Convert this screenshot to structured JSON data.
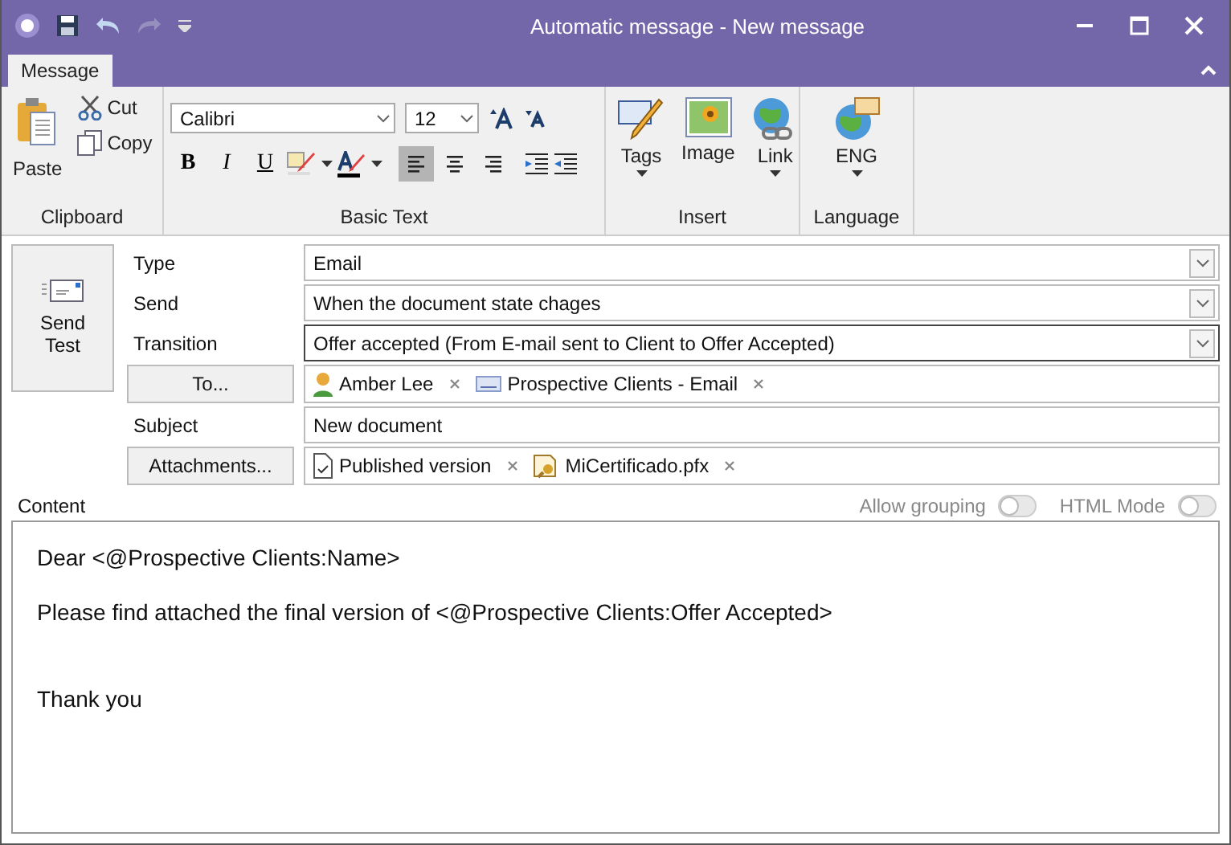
{
  "window": {
    "title": "Automatic message - New message"
  },
  "tabs": [
    {
      "label": "Message",
      "selected": true
    }
  ],
  "ribbon": {
    "clipboard": {
      "label": "Clipboard",
      "paste": "Paste",
      "cut": "Cut",
      "copy": "Copy"
    },
    "basic_text": {
      "label": "Basic Text",
      "font": "Calibri",
      "size": "12",
      "format": [
        {
          "kind": "bold",
          "label": "B"
        },
        {
          "kind": "italic",
          "label": "I"
        },
        {
          "kind": "underline",
          "label": "U"
        }
      ],
      "alignment": [
        {
          "kind": "left",
          "selected": true
        },
        {
          "kind": "center",
          "selected": false
        },
        {
          "kind": "right",
          "selected": false
        }
      ]
    },
    "insert": {
      "label": "Insert",
      "buttons": [
        {
          "kind": "tags",
          "label": "Tags",
          "dropdown": true
        },
        {
          "kind": "image",
          "label": "Image",
          "dropdown": false
        },
        {
          "kind": "link",
          "label": "Link",
          "dropdown": true
        }
      ]
    },
    "language": {
      "label": "Language",
      "value": "ENG"
    }
  },
  "send_test": "Send Test",
  "fields": [
    {
      "kind": "select",
      "label": "Type",
      "value": "Email",
      "focused": false
    },
    {
      "kind": "select",
      "label": "Send",
      "value": "When the document state chages",
      "focused": false
    },
    {
      "kind": "select",
      "label": "Transition",
      "value": "Offer accepted (From E-mail sent to Client to Offer Accepted)",
      "focused": true
    },
    {
      "kind": "chips",
      "button": "To...",
      "chips": [
        {
          "kind": "contact",
          "text": "Amber Lee"
        },
        {
          "kind": "group",
          "text": "Prospective Clients - Email"
        }
      ]
    },
    {
      "kind": "text",
      "label": "Subject",
      "value": "New document",
      "focused": false
    },
    {
      "kind": "chips",
      "button": "Attachments...",
      "chips": [
        {
          "kind": "document",
          "text": "Published version"
        },
        {
          "kind": "certificate",
          "text": "MiCertificado.pfx"
        }
      ]
    }
  ],
  "content": {
    "label": "Content",
    "toggles": [
      {
        "label": "Allow grouping",
        "on": false
      },
      {
        "label": "HTML Mode",
        "on": false
      }
    ],
    "paragraphs": [
      "Dear <@Prospective Clients:Name>",
      "Please find attached the final version of <@Prospective Clients:Offer Accepted>",
      "Thank you"
    ]
  }
}
